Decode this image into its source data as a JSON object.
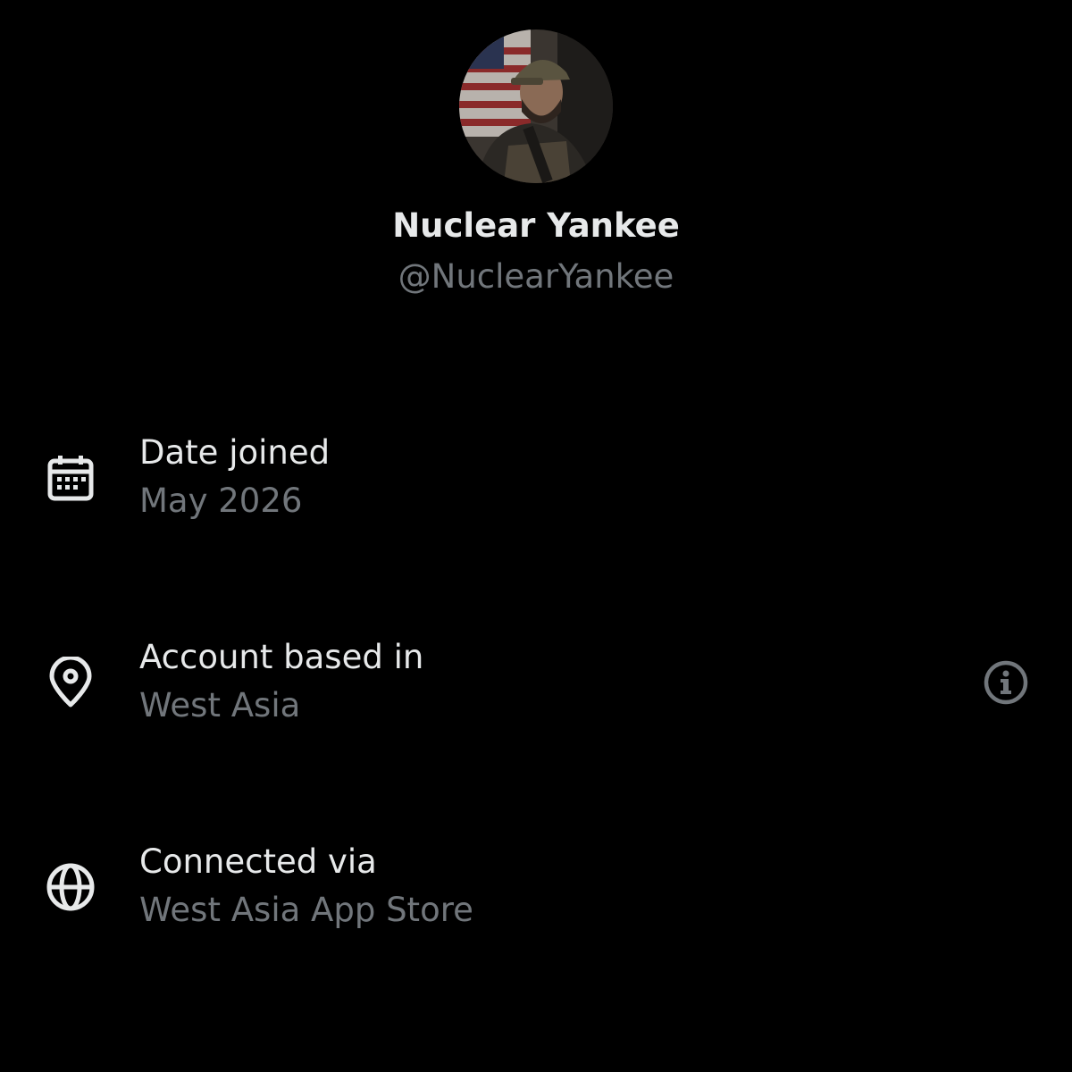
{
  "profile": {
    "display_name": "Nuclear Yankee",
    "handle": "@NuclearYankee"
  },
  "rows": [
    {
      "icon": "calendar-icon",
      "label": "Date joined",
      "value": "May 2026"
    },
    {
      "icon": "location-pin-icon",
      "label": "Account based in",
      "value": "West Asia",
      "action_icon": "info-icon"
    },
    {
      "icon": "globe-icon",
      "label": "Connected via",
      "value": "West Asia App Store"
    }
  ],
  "colors": {
    "background": "#000000",
    "primary_text": "#e7e9ea",
    "secondary_text": "#71767b",
    "icon": "#e7e9ea",
    "info_icon": "#71767b"
  }
}
